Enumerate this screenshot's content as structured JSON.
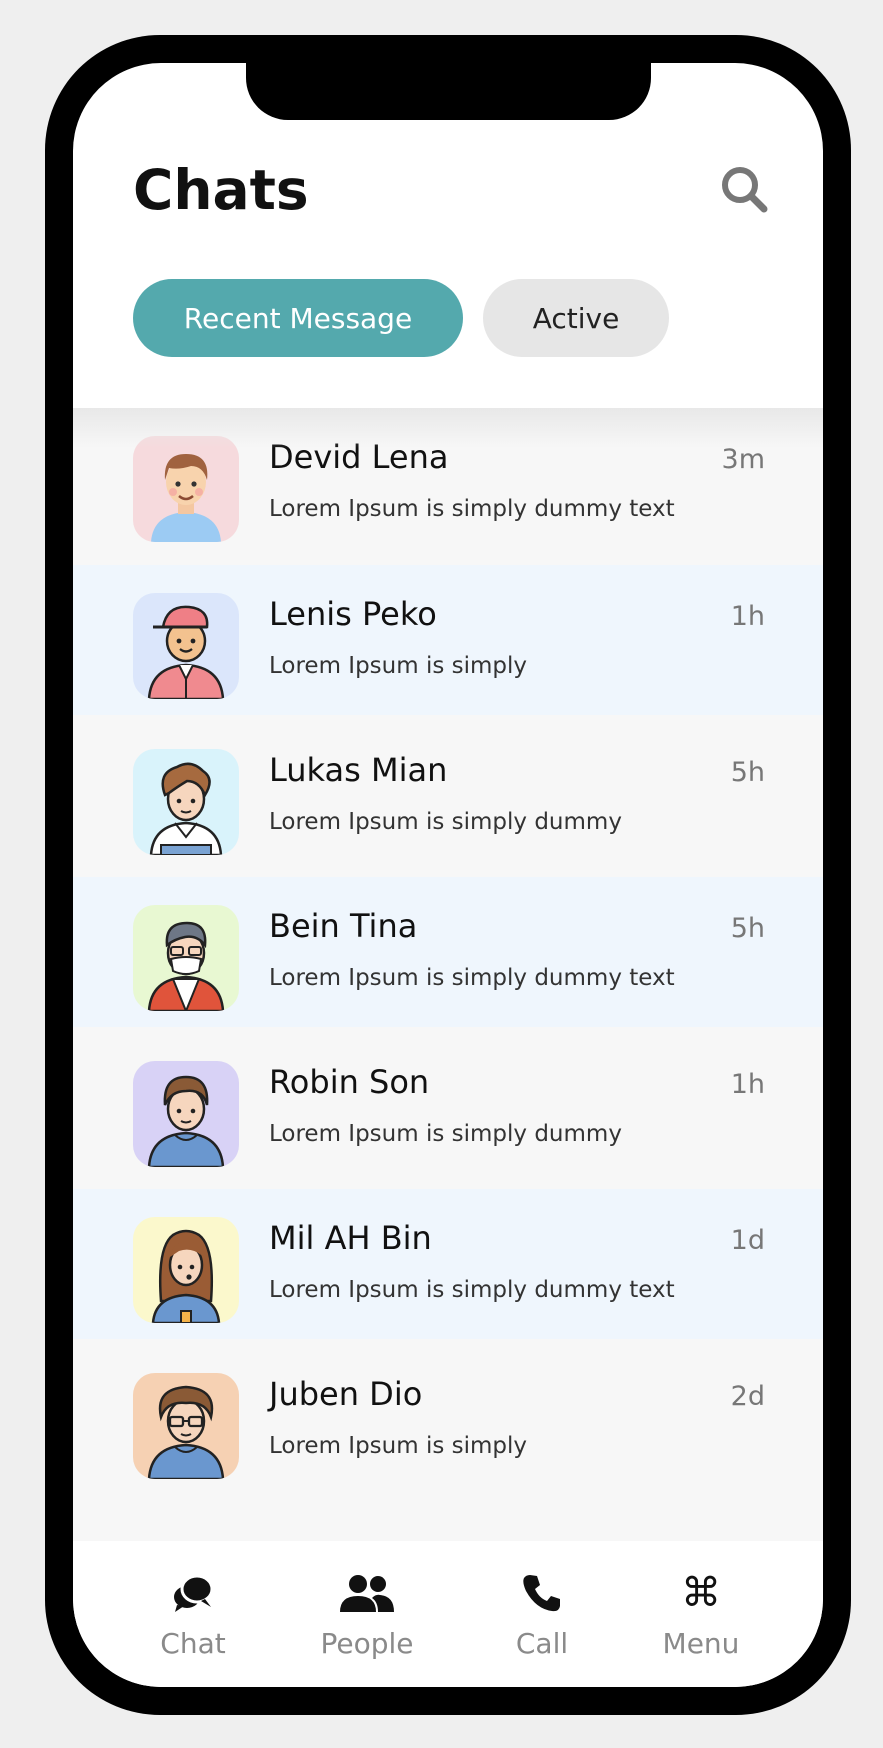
{
  "header": {
    "title": "Chats",
    "search_icon": "search-icon"
  },
  "tabs": [
    {
      "label": "Recent Message",
      "selected": true
    },
    {
      "label": "Active",
      "selected": false
    }
  ],
  "chats": [
    {
      "name": "Devid Lena",
      "preview": "Lorem Ipsum is simply dummy text",
      "time": "3m",
      "avatar_bg": "#f6dadd"
    },
    {
      "name": "Lenis Peko",
      "preview": "Lorem Ipsum is simply",
      "time": "1h",
      "avatar_bg": "#dbe6fb"
    },
    {
      "name": "Lukas Mian",
      "preview": "Lorem Ipsum is simply dummy",
      "time": "5h",
      "avatar_bg": "#d9f3fb"
    },
    {
      "name": "Bein Tina",
      "preview": "Lorem Ipsum is simply dummy text",
      "time": "5h",
      "avatar_bg": "#e8f8d2"
    },
    {
      "name": "Robin Son",
      "preview": "Lorem Ipsum is simply dummy",
      "time": "1h",
      "avatar_bg": "#d8d2f6"
    },
    {
      "name": "Mil AH Bin",
      "preview": "Lorem Ipsum is simply dummy text",
      "time": "1d",
      "avatar_bg": "#fbf8cc"
    },
    {
      "name": "Juben Dio",
      "preview": "Lorem Ipsum is simply",
      "time": "2d",
      "avatar_bg": "#f6d1b3"
    }
  ],
  "bottom_nav": [
    {
      "label": "Chat",
      "icon": "chat-bubbles-icon"
    },
    {
      "label": "People",
      "icon": "people-icon"
    },
    {
      "label": "Call",
      "icon": "phone-icon"
    },
    {
      "label": "Menu",
      "icon": "command-icon",
      "glyph": "⌘"
    }
  ],
  "colors": {
    "accent": "#54a9ad",
    "row_alt": "#eff6fd",
    "row": "#f7f7f7",
    "muted_text": "#8a8a8a"
  }
}
